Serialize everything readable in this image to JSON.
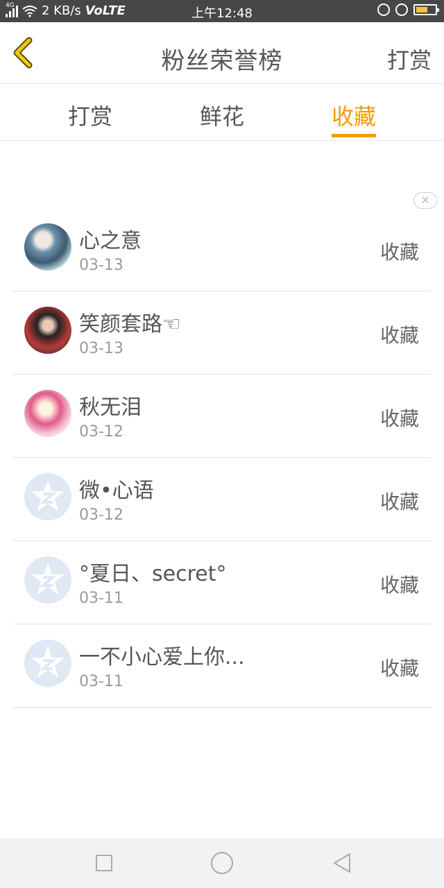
{
  "status_bar": {
    "network": "4G",
    "speed": "2 KB/s",
    "volte": "VoLTE",
    "time": "上午12:48"
  },
  "header": {
    "title": "粉丝荣誉榜",
    "action_label": "打赏"
  },
  "tabs": [
    {
      "label": "打赏",
      "active": false
    },
    {
      "label": "鲜花",
      "active": false
    },
    {
      "label": "收藏",
      "active": true
    }
  ],
  "accent_color": "#f59b00",
  "close_ad_symbol": "✕",
  "list": [
    {
      "name": "心之意",
      "date": "03-13",
      "action": "收藏",
      "avatar": "custom-photo"
    },
    {
      "name": "笑颜套路☜",
      "date": "03-13",
      "action": "收藏",
      "avatar": "custom-photo"
    },
    {
      "name": "秋无泪",
      "date": "03-12",
      "action": "收藏",
      "avatar": "custom-photo"
    },
    {
      "name": "微•心语",
      "date": "03-12",
      "action": "收藏",
      "avatar": "default-qq-star-icon"
    },
    {
      "name": "°夏日、secret°",
      "date": "03-11",
      "action": "收藏",
      "avatar": "default-qq-star-icon"
    },
    {
      "name": "一不小心爱上你...",
      "date": "03-11",
      "action": "收藏",
      "avatar": "default-qq-star-icon"
    }
  ]
}
